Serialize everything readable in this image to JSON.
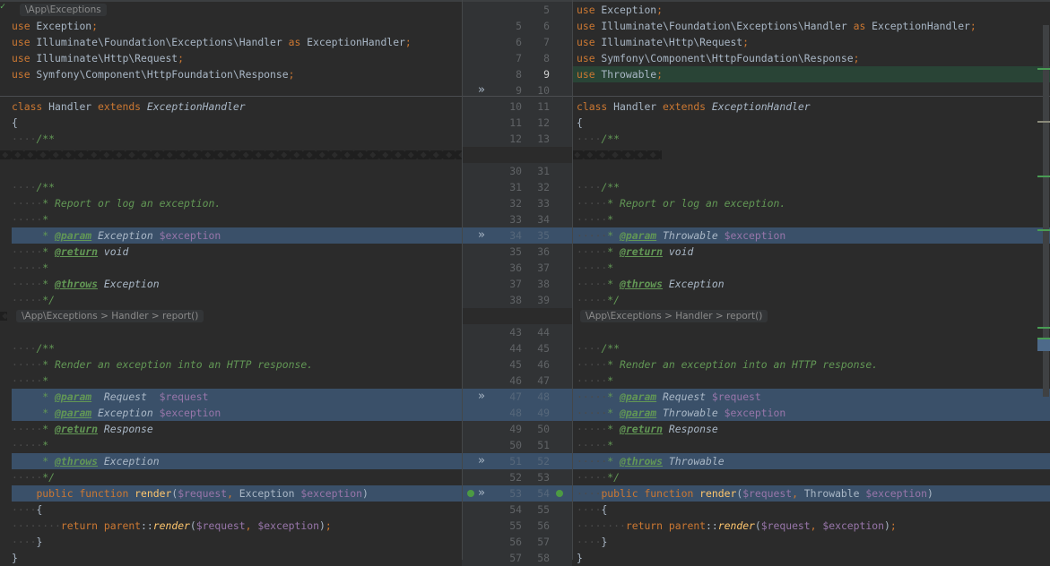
{
  "breadcrumbs": {
    "left_top": "\\App\\Exceptions",
    "left_mid": "\\App\\Exceptions > Handler > report()",
    "right_mid": "\\App\\Exceptions > Handler > report()"
  },
  "colors": {
    "background": "#2b2b2b",
    "gutter": "#313335",
    "changed_line": "#3a5069",
    "inserted_line": "#294436",
    "keyword": "#cc7832",
    "doc_comment": "#629755",
    "variable": "#9876aa"
  },
  "icons": {
    "apply_change": "chevron-double-right-icon",
    "implements_marker": "implements-icon",
    "fold": "collapsed-fold-icon"
  },
  "rows": [
    {
      "type": "crumb",
      "ln": "",
      "rn": "5",
      "l": [],
      "r": [
        [
          "use",
          "kw"
        ],
        [
          " Exception"
        ],
        [
          ";",
          "kw"
        ]
      ]
    },
    {
      "ln": "5",
      "rn": "6",
      "l": [
        [
          "use",
          "kw"
        ],
        [
          " Exception"
        ],
        [
          ";",
          "kw"
        ]
      ],
      "r": [
        [
          "use",
          "kw"
        ],
        [
          " Illuminate\\Foundation\\Exceptions\\Handler "
        ],
        [
          "as",
          "kw"
        ],
        [
          " ExceptionHandler"
        ],
        [
          ";",
          "kw"
        ]
      ]
    },
    {
      "ln": "6",
      "rn": "7",
      "l": [
        [
          "use",
          "kw"
        ],
        [
          " Illuminate\\Foundation\\Exceptions\\Handler "
        ],
        [
          "as",
          "kw"
        ],
        [
          " ExceptionHandler"
        ],
        [
          ";",
          "kw"
        ]
      ],
      "r": [
        [
          "use",
          "kw"
        ],
        [
          " Illuminate\\Http\\Request"
        ],
        [
          ";",
          "kw"
        ]
      ]
    },
    {
      "ln": "7",
      "rn": "8",
      "l": [
        [
          "use",
          "kw"
        ],
        [
          " Illuminate\\Http\\Request"
        ],
        [
          ";",
          "kw"
        ]
      ],
      "r": [
        [
          "use",
          "kw"
        ],
        [
          " Symfony\\Component\\HttpFoundation\\Response"
        ],
        [
          ";",
          "kw"
        ]
      ]
    },
    {
      "hl": "green",
      "ln": "8",
      "rn": "9",
      "l": [
        [
          "use",
          "kw"
        ],
        [
          " Symfony\\Component\\HttpFoundation\\Response"
        ],
        [
          ";",
          "kw"
        ]
      ],
      "r": [
        [
          "use",
          "kw"
        ],
        [
          " Throwable"
        ],
        [
          ";",
          "kw"
        ]
      ]
    },
    {
      "mark": "»",
      "ln": "9",
      "rn": "10",
      "l": [],
      "r": []
    },
    {
      "ln": "10",
      "rn": "11",
      "l": [
        [
          "class",
          "kw"
        ],
        [
          " Handler "
        ],
        [
          "extends",
          "kw"
        ],
        [
          " "
        ],
        [
          "ExceptionHandler",
          "it"
        ]
      ],
      "r": [
        [
          "class",
          "kw"
        ],
        [
          " Handler "
        ],
        [
          "extends",
          "kw"
        ],
        [
          " "
        ],
        [
          "ExceptionHandler",
          "it"
        ]
      ]
    },
    {
      "ln": "11",
      "rn": "12",
      "l": [
        [
          "{"
        ]
      ],
      "r": [
        [
          "{"
        ]
      ]
    },
    {
      "ln": "12",
      "rn": "13",
      "l": [
        [
          "····",
          "ws"
        ],
        [
          "/**",
          "cm"
        ]
      ],
      "r": [
        [
          "····",
          "ws"
        ],
        [
          "/**",
          "cm"
        ]
      ]
    },
    {
      "type": "fold",
      "ln": "",
      "rn": "",
      "l": [],
      "r": []
    },
    {
      "ln": "30",
      "rn": "31",
      "l": [],
      "r": []
    },
    {
      "ln": "31",
      "rn": "32",
      "l": [
        [
          "····",
          "ws"
        ],
        [
          "/**",
          "cm"
        ]
      ],
      "r": [
        [
          "····",
          "ws"
        ],
        [
          "/**",
          "cm"
        ]
      ]
    },
    {
      "ln": "32",
      "rn": "33",
      "l": [
        [
          "·····",
          "ws"
        ],
        [
          "* Report or log an exception.",
          "cm"
        ]
      ],
      "r": [
        [
          "·····",
          "ws"
        ],
        [
          "* Report or log an exception.",
          "cm"
        ]
      ]
    },
    {
      "ln": "33",
      "rn": "34",
      "l": [
        [
          "·····",
          "ws"
        ],
        [
          "*",
          "cm"
        ]
      ],
      "r": [
        [
          "·····",
          "ws"
        ],
        [
          "*",
          "cm"
        ]
      ]
    },
    {
      "hl": "blue",
      "mark": "»",
      "ln": "34",
      "rn": "35",
      "l": [
        [
          "     "
        ],
        [
          "* ",
          "cm"
        ],
        [
          "@param",
          "tag"
        ],
        [
          " Exception ",
          "dt"
        ],
        [
          "$exception",
          "var"
        ]
      ],
      "r": [
        [
          "·····",
          "ws"
        ],
        [
          "* ",
          "cm"
        ],
        [
          "@param",
          "tag"
        ],
        [
          " Throwable ",
          "dt"
        ],
        [
          "$exception",
          "var"
        ]
      ]
    },
    {
      "ln": "35",
      "rn": "36",
      "l": [
        [
          "·····",
          "ws"
        ],
        [
          "* ",
          "cm"
        ],
        [
          "@return",
          "tag"
        ],
        [
          " void",
          "dt"
        ]
      ],
      "r": [
        [
          "·····",
          "ws"
        ],
        [
          "* ",
          "cm"
        ],
        [
          "@return",
          "tag"
        ],
        [
          " void",
          "dt"
        ]
      ]
    },
    {
      "ln": "36",
      "rn": "37",
      "l": [
        [
          "·····",
          "ws"
        ],
        [
          "*",
          "cm"
        ]
      ],
      "r": [
        [
          "·····",
          "ws"
        ],
        [
          "*",
          "cm"
        ]
      ]
    },
    {
      "ln": "37",
      "rn": "38",
      "l": [
        [
          "·····",
          "ws"
        ],
        [
          "* ",
          "cm"
        ],
        [
          "@throws",
          "tag"
        ],
        [
          " Exception",
          "dt"
        ]
      ],
      "r": [
        [
          "·····",
          "ws"
        ],
        [
          "* ",
          "cm"
        ],
        [
          "@throws",
          "tag"
        ],
        [
          " Exception",
          "dt"
        ]
      ]
    },
    {
      "ln": "38",
      "rn": "39",
      "l": [
        [
          "·····",
          "ws"
        ],
        [
          "*/",
          "cm"
        ]
      ],
      "r": [
        [
          "·····",
          "ws"
        ],
        [
          "*/",
          "cm"
        ]
      ]
    },
    {
      "type": "fold-crumb",
      "ln": "",
      "rn": "",
      "l": [],
      "r": []
    },
    {
      "ln": "43",
      "rn": "44",
      "l": [],
      "r": []
    },
    {
      "ln": "44",
      "rn": "45",
      "l": [
        [
          "····",
          "ws"
        ],
        [
          "/**",
          "cm"
        ]
      ],
      "r": [
        [
          "····",
          "ws"
        ],
        [
          "/**",
          "cm"
        ]
      ]
    },
    {
      "ln": "45",
      "rn": "46",
      "l": [
        [
          "·····",
          "ws"
        ],
        [
          "* Render an exception into an HTTP response.",
          "cm"
        ]
      ],
      "r": [
        [
          "·····",
          "ws"
        ],
        [
          "* Render an exception into an HTTP response.",
          "cm"
        ]
      ]
    },
    {
      "ln": "46",
      "rn": "47",
      "l": [
        [
          "·····",
          "ws"
        ],
        [
          "*",
          "cm"
        ]
      ],
      "r": [
        [
          "·····",
          "ws"
        ],
        [
          "*",
          "cm"
        ]
      ]
    },
    {
      "hl": "blue",
      "mark": "»",
      "ln": "47",
      "rn": "48",
      "l": [
        [
          "     "
        ],
        [
          "* ",
          "cm"
        ],
        [
          "@param",
          "tag"
        ],
        [
          "  Request  ",
          "dt"
        ],
        [
          "$request",
          "var"
        ]
      ],
      "r": [
        [
          "·····",
          "ws"
        ],
        [
          "* ",
          "cm"
        ],
        [
          "@param",
          "tag"
        ],
        [
          " Request ",
          "dt"
        ],
        [
          "$request",
          "var"
        ]
      ]
    },
    {
      "hl": "blue",
      "ln": "48",
      "rn": "49",
      "l": [
        [
          "     "
        ],
        [
          "* ",
          "cm"
        ],
        [
          "@param",
          "tag"
        ],
        [
          " Exception ",
          "dt"
        ],
        [
          "$exception",
          "var"
        ]
      ],
      "r": [
        [
          "·····",
          "ws"
        ],
        [
          "* ",
          "cm"
        ],
        [
          "@param",
          "tag"
        ],
        [
          " Throwable ",
          "dt"
        ],
        [
          "$exception",
          "var"
        ]
      ]
    },
    {
      "ln": "49",
      "rn": "50",
      "l": [
        [
          "·····",
          "ws"
        ],
        [
          "* ",
          "cm"
        ],
        [
          "@return",
          "tag"
        ],
        [
          " Response",
          "dt"
        ]
      ],
      "r": [
        [
          "·····",
          "ws"
        ],
        [
          "* ",
          "cm"
        ],
        [
          "@return",
          "tag"
        ],
        [
          " Response",
          "dt"
        ]
      ]
    },
    {
      "ln": "50",
      "rn": "51",
      "l": [
        [
          "·····",
          "ws"
        ],
        [
          "*",
          "cm"
        ]
      ],
      "r": [
        [
          "·····",
          "ws"
        ],
        [
          "*",
          "cm"
        ]
      ]
    },
    {
      "hl": "blue",
      "mark": "»",
      "ln": "51",
      "rn": "52",
      "l": [
        [
          "     "
        ],
        [
          "* ",
          "cm"
        ],
        [
          "@throws",
          "tag"
        ],
        [
          " Exception",
          "dt"
        ]
      ],
      "r": [
        [
          "·····",
          "ws"
        ],
        [
          "* ",
          "cm"
        ],
        [
          "@throws",
          "tag"
        ],
        [
          " Throwable",
          "dt"
        ]
      ]
    },
    {
      "ln": "52",
      "rn": "53",
      "l": [
        [
          "·····",
          "ws"
        ],
        [
          "*/",
          "cm"
        ]
      ],
      "r": [
        [
          "·····",
          "ws"
        ],
        [
          "*/",
          "cm"
        ]
      ]
    },
    {
      "hl": "blue",
      "mark": "»",
      "icons": true,
      "ln": "53",
      "rn": "54",
      "l": [
        [
          "    "
        ],
        [
          "public function",
          "kw"
        ],
        [
          " "
        ],
        [
          "render",
          "fnn"
        ],
        [
          "("
        ],
        [
          "$request",
          "var"
        ],
        [
          ", ",
          "kw"
        ],
        [
          "Exception "
        ],
        [
          "$exception",
          "var"
        ],
        [
          ")"
        ]
      ],
      "r": [
        [
          "····",
          "ws"
        ],
        [
          "public function",
          "kw"
        ],
        [
          " "
        ],
        [
          "render",
          "fnn"
        ],
        [
          "("
        ],
        [
          "$request",
          "var"
        ],
        [
          ", ",
          "kw"
        ],
        [
          "Throwable "
        ],
        [
          "$exception",
          "var"
        ],
        [
          ")"
        ]
      ]
    },
    {
      "ln": "54",
      "rn": "55",
      "l": [
        [
          "····",
          "ws"
        ],
        [
          "{"
        ]
      ],
      "r": [
        [
          "····",
          "ws"
        ],
        [
          "{"
        ]
      ]
    },
    {
      "ln": "55",
      "rn": "56",
      "l": [
        [
          "········",
          "ws"
        ],
        [
          "return",
          "kw"
        ],
        [
          " "
        ],
        [
          "parent",
          "kw"
        ],
        [
          "::"
        ],
        [
          "render",
          "fn"
        ],
        [
          "("
        ],
        [
          "$request",
          "var"
        ],
        [
          ", ",
          "kw"
        ],
        [
          "$exception",
          "var"
        ],
        [
          ")"
        ],
        [
          ";",
          "kw"
        ]
      ],
      "r": [
        [
          "········",
          "ws"
        ],
        [
          "return",
          "kw"
        ],
        [
          " "
        ],
        [
          "parent",
          "kw"
        ],
        [
          "::"
        ],
        [
          "render",
          "fn"
        ],
        [
          "("
        ],
        [
          "$request",
          "var"
        ],
        [
          ", ",
          "kw"
        ],
        [
          "$exception",
          "var"
        ],
        [
          ")"
        ],
        [
          ";",
          "kw"
        ]
      ]
    },
    {
      "ln": "56",
      "rn": "57",
      "l": [
        [
          "····",
          "ws"
        ],
        [
          "}"
        ]
      ],
      "r": [
        [
          "····",
          "ws"
        ],
        [
          "}"
        ]
      ]
    },
    {
      "ln": "57",
      "rn": "58",
      "l": [
        [
          "}"
        ]
      ],
      "r": [
        [
          "}"
        ]
      ]
    }
  ]
}
